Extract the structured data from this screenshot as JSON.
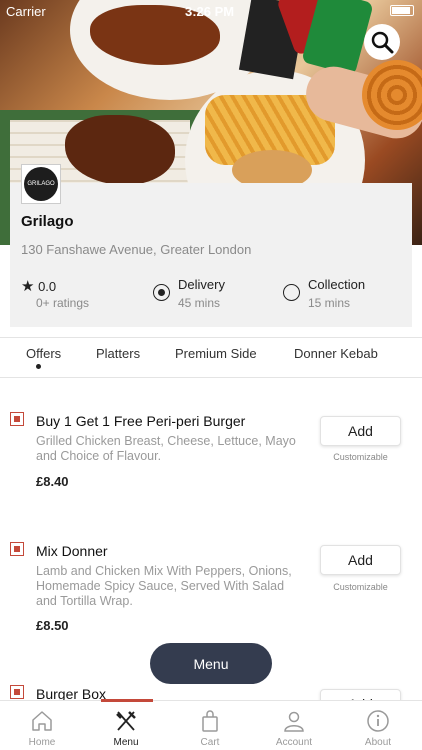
{
  "status_bar": {
    "carrier": "Carrier",
    "time": "3:26 PM"
  },
  "restaurant": {
    "logo_text": "GRILAGO",
    "name": "Grilago",
    "address": "130 Fanshawe Avenue, Greater London",
    "rating": "0.0",
    "rating_count": "0+ ratings"
  },
  "order_options": {
    "delivery": {
      "label": "Delivery",
      "time": "45 mins",
      "selected": true
    },
    "collection": {
      "label": "Collection",
      "time": "15 mins",
      "selected": false
    }
  },
  "tabs": [
    {
      "label": "Offers",
      "active": true
    },
    {
      "label": "Platters"
    },
    {
      "label": "Premium Side"
    },
    {
      "label": "Donner Kebab"
    }
  ],
  "items": [
    {
      "title": "Buy 1 Get 1 Free Peri-peri Burger",
      "description": "Grilled Chicken Breast, Cheese, Lettuce, Mayo and Choice of Flavour.",
      "price": "£8.40",
      "add_label": "Add",
      "customizable": "Customizable"
    },
    {
      "title": "Mix Donner",
      "description": "Lamb and Chicken Mix With Peppers, Onions, Homemade Spicy Sauce, Served With Salad and Tortilla Wrap.",
      "price": "£8.50",
      "add_label": "Add",
      "customizable": "Customizable"
    },
    {
      "title": "Burger Box",
      "add_label": "Add"
    }
  ],
  "menu_button": "Menu",
  "bottom_nav": [
    {
      "label": "Home",
      "icon": "home-icon"
    },
    {
      "label": "Menu",
      "icon": "fork-knife-icon",
      "active": true
    },
    {
      "label": "Cart",
      "icon": "bag-icon"
    },
    {
      "label": "Account",
      "icon": "person-icon"
    },
    {
      "label": "About",
      "icon": "info-icon"
    }
  ],
  "colors": {
    "accent": "#c4493a",
    "fab": "#343c4f"
  }
}
